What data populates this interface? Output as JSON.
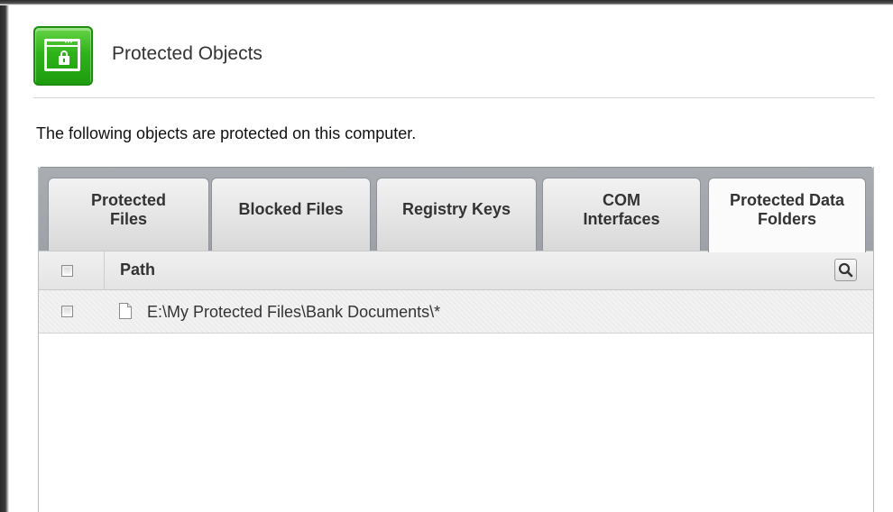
{
  "header": {
    "title": "Protected Objects",
    "icon": "lock-window-icon",
    "icon_color": "#2fb31a"
  },
  "description": "The following objects are protected on this computer.",
  "tabs": [
    {
      "label": "Protected Files",
      "active": false
    },
    {
      "label": "Blocked Files",
      "active": false
    },
    {
      "label": "Registry Keys",
      "active": false
    },
    {
      "label": "COM Interfaces",
      "active": false
    },
    {
      "label": "Protected Data Folders",
      "active": true
    }
  ],
  "grid": {
    "columns": {
      "path": "Path"
    },
    "search_icon": "search-icon",
    "rows": [
      {
        "path": "E:\\My Protected Files\\Bank Documents\\*",
        "checked": false,
        "icon": "file-icon"
      }
    ]
  }
}
